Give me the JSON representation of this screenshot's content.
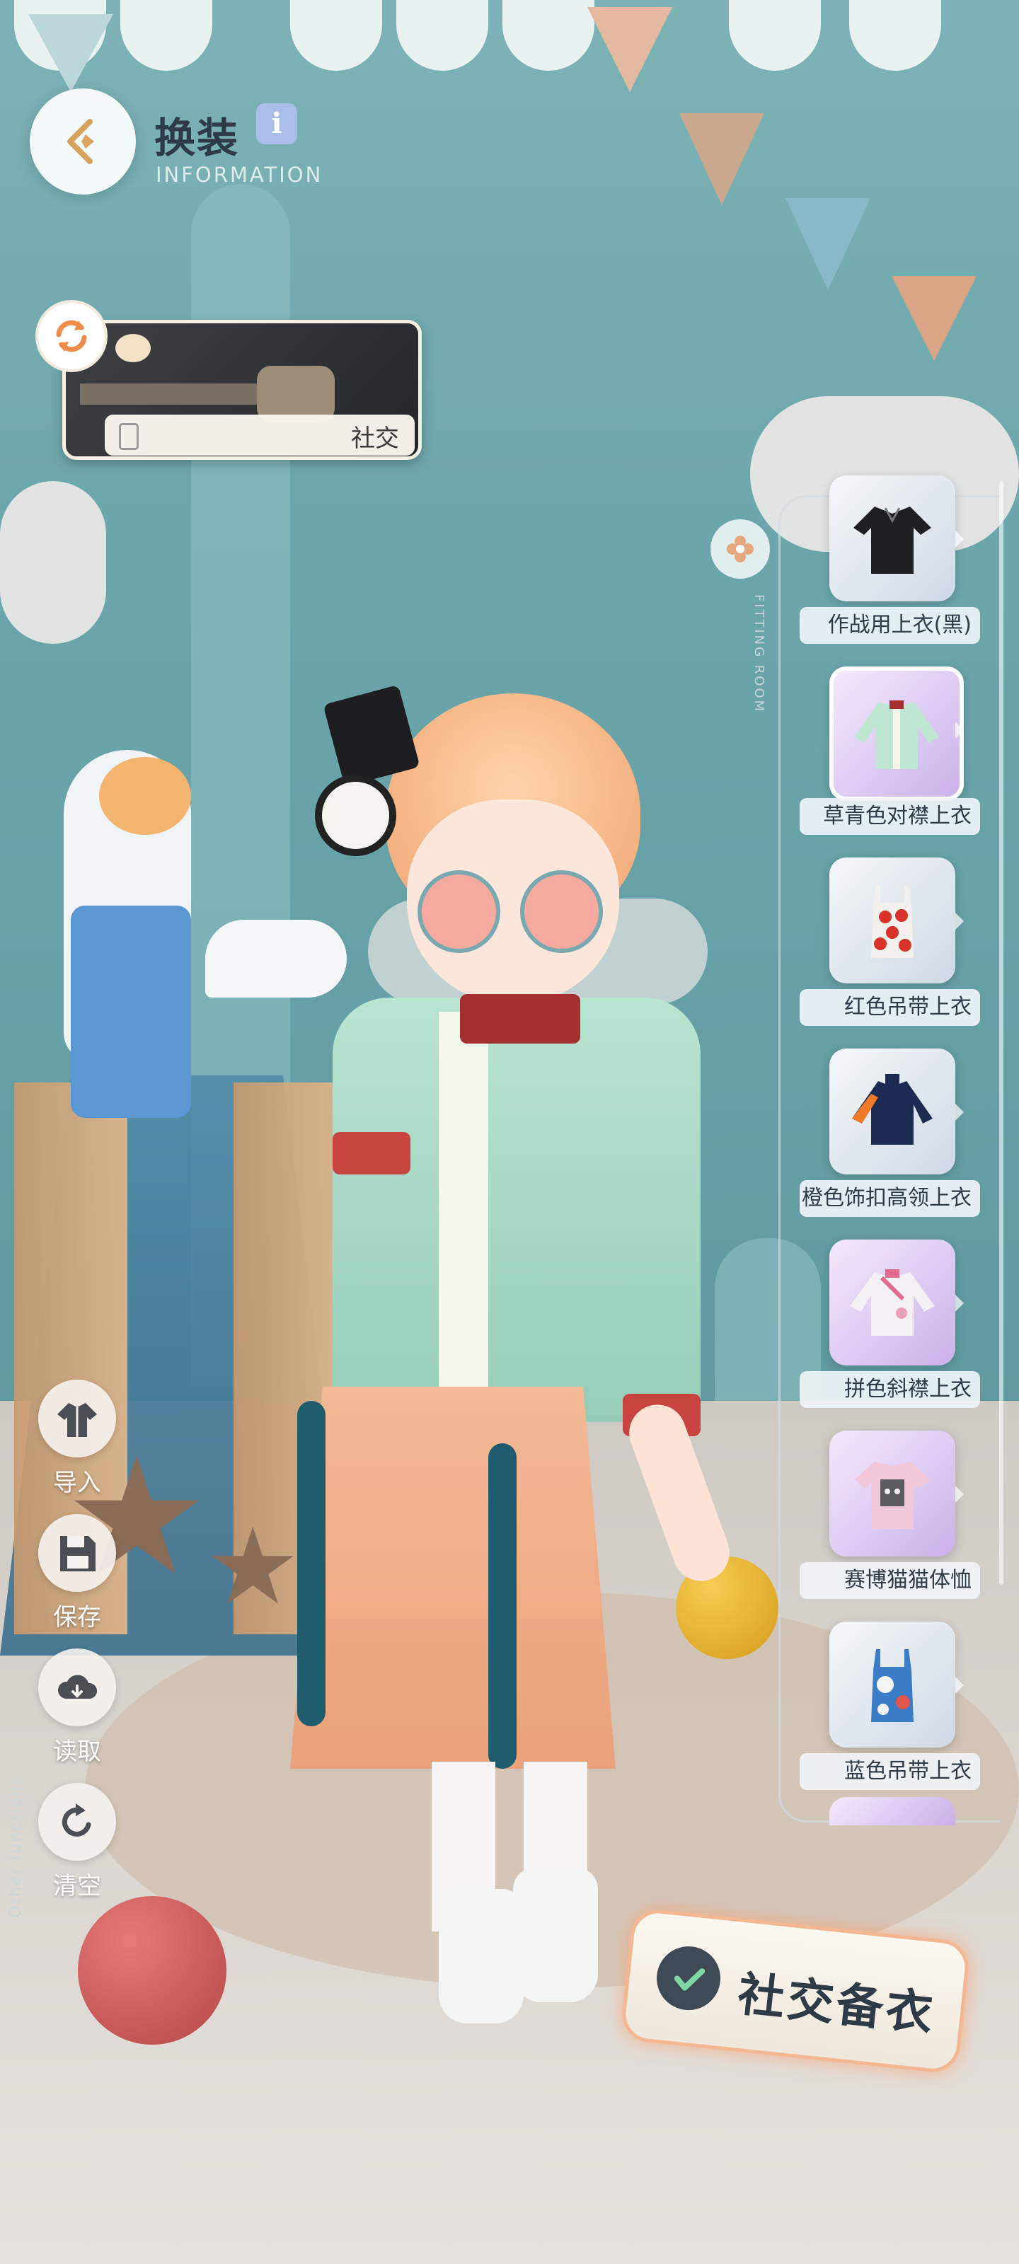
{
  "header": {
    "title": "换装",
    "info_icon": "i",
    "subtitle": "INFORMATION"
  },
  "scene_selector": {
    "label": "社交"
  },
  "panel": {
    "vertical_text": "FITTING ROOM"
  },
  "clothing_items": [
    {
      "label": "作战用上衣(黑)",
      "icon": "black-jacket-icon",
      "style": "silver",
      "color": "#1f1f24"
    },
    {
      "label": "草青色对襟上衣",
      "icon": "green-jacket-icon",
      "style": "purple",
      "color": "#bfe6d3",
      "selected": true
    },
    {
      "label": "红色吊带上衣",
      "icon": "red-camisole-icon",
      "style": "silver",
      "color": "#d9322b"
    },
    {
      "label": "橙色饰扣高领上衣",
      "icon": "navy-highneck-icon",
      "style": "silver",
      "color": "#1d2b52"
    },
    {
      "label": "拼色斜襟上衣",
      "icon": "white-jacket-icon",
      "style": "purple",
      "color": "#f4f0f4"
    },
    {
      "label": "赛博猫猫体恤",
      "icon": "cat-tshirt-icon",
      "style": "purple",
      "color": "#f2c8d8"
    },
    {
      "label": "蓝色吊带上衣",
      "icon": "blue-camisole-icon",
      "style": "silver",
      "color": "#3b7ec7"
    }
  ],
  "side_actions": {
    "import": "导入",
    "save": "保存",
    "load": "读取",
    "clear": "清空",
    "group_label": "Other functions"
  },
  "confirm": {
    "label": "社交备衣"
  },
  "colors": {
    "accent": "#f3b891",
    "text_dark": "#2f3a47",
    "wall": "#6aa6aa"
  }
}
